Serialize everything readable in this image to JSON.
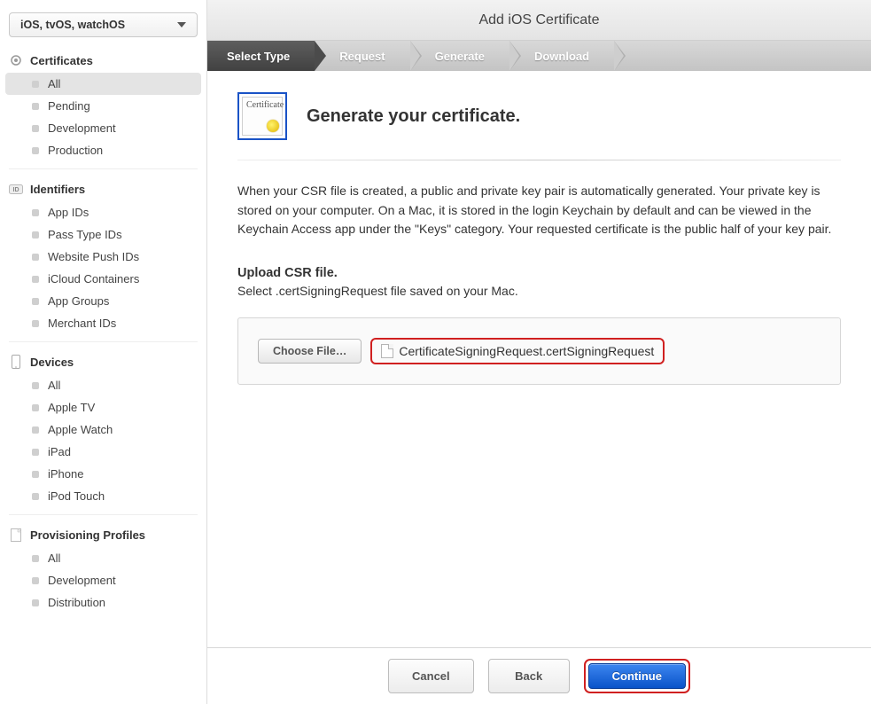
{
  "platform_selector": "iOS, tvOS, watchOS",
  "sidebar": {
    "sections": [
      {
        "title": "Certificates",
        "items": [
          {
            "label": "All",
            "active": true
          },
          {
            "label": "Pending"
          },
          {
            "label": "Development"
          },
          {
            "label": "Production"
          }
        ]
      },
      {
        "title": "Identifiers",
        "items": [
          {
            "label": "App IDs"
          },
          {
            "label": "Pass Type IDs"
          },
          {
            "label": "Website Push IDs"
          },
          {
            "label": "iCloud Containers"
          },
          {
            "label": "App Groups"
          },
          {
            "label": "Merchant IDs"
          }
        ]
      },
      {
        "title": "Devices",
        "items": [
          {
            "label": "All"
          },
          {
            "label": "Apple TV"
          },
          {
            "label": "Apple Watch"
          },
          {
            "label": "iPad"
          },
          {
            "label": "iPhone"
          },
          {
            "label": "iPod Touch"
          }
        ]
      },
      {
        "title": "Provisioning Profiles",
        "items": [
          {
            "label": "All"
          },
          {
            "label": "Development"
          },
          {
            "label": "Distribution"
          }
        ]
      }
    ]
  },
  "header": {
    "title": "Add iOS Certificate"
  },
  "steps": [
    {
      "label": "Select Type",
      "current": true
    },
    {
      "label": "Request"
    },
    {
      "label": "Generate"
    },
    {
      "label": "Download"
    }
  ],
  "main": {
    "cert_icon_text": "Certificate",
    "heading": "Generate your certificate.",
    "body": "When your CSR file is created, a public and private key pair is automatically generated. Your private key is stored on your computer. On a Mac, it is stored in the login Keychain by default and can be viewed in the Keychain Access app under the \"Keys\" category. Your requested certificate is the public half of your key pair.",
    "upload_title": "Upload CSR file.",
    "upload_sub": "Select .certSigningRequest file saved on your Mac.",
    "choose_file_label": "Choose File…",
    "selected_file": "CertificateSigningRequest.certSigningRequest"
  },
  "footer": {
    "cancel": "Cancel",
    "back": "Back",
    "continue": "Continue"
  }
}
